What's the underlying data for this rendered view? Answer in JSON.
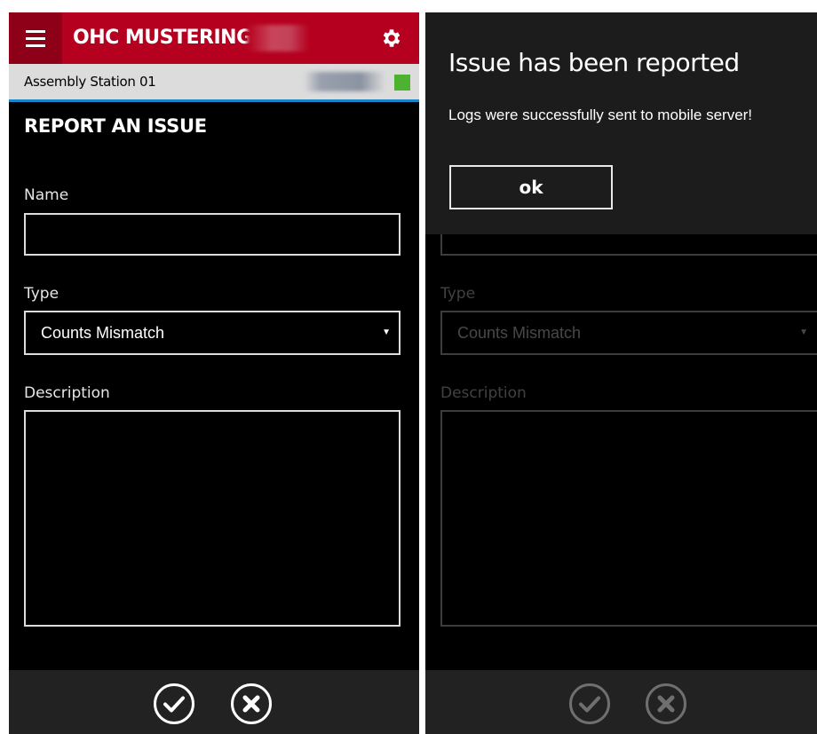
{
  "left": {
    "app_title": "OHC MUSTERING",
    "station": "Assembly Station 01",
    "page_title": "REPORT AN ISSUE",
    "name_label": "Name",
    "name_value": "",
    "type_label": "Type",
    "type_value": "Counts Mismatch",
    "description_label": "Description",
    "description_value": ""
  },
  "right": {
    "dialog_title": "Issue has been reported",
    "dialog_message": "Logs were successfully sent to mobile server!",
    "ok_label": "ok",
    "type_label": "Type",
    "type_value": "Counts Mismatch",
    "description_label": "Description"
  },
  "colors": {
    "brand_red": "#b5001f",
    "brand_red_dark": "#8e0018",
    "accent_blue": "#1a86c8",
    "status_green": "#4cb22f"
  },
  "icons": {
    "menu": "hamburger-menu-icon",
    "settings": "gear-icon",
    "confirm": "checkmark-circle-icon",
    "cancel": "close-circle-icon"
  }
}
